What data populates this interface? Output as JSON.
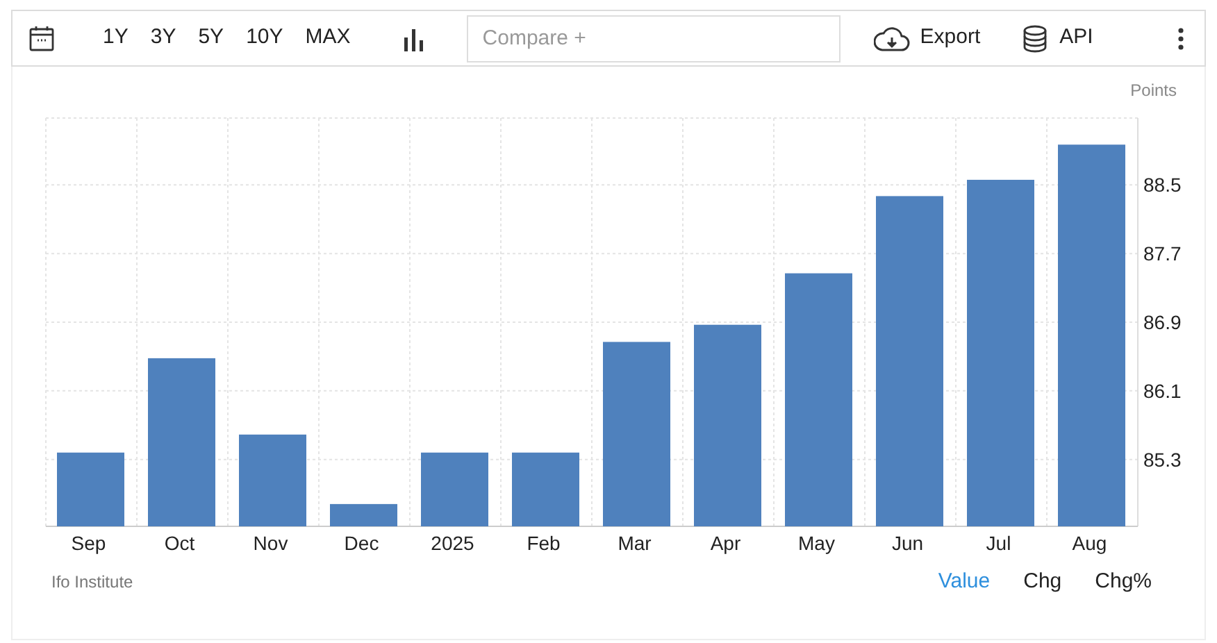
{
  "toolbar": {
    "ranges": [
      {
        "label": "1Y"
      },
      {
        "label": "3Y"
      },
      {
        "label": "5Y"
      },
      {
        "label": "10Y"
      },
      {
        "label": "MAX"
      }
    ],
    "compare": {
      "placeholder": "Compare +"
    },
    "export": "Export",
    "api": "API"
  },
  "chart": {
    "unit": "Points",
    "chart_data": {
      "type": "bar",
      "categories": [
        "Sep",
        "Oct",
        "Nov",
        "Dec",
        "2025",
        "Feb",
        "Mar",
        "Apr",
        "May",
        "Jun",
        "Jul",
        "Aug"
      ],
      "grid": true,
      "series": [
        {
          "color": "#4f81bd",
          "values": [
            85.38,
            86.48,
            85.59,
            84.78,
            85.38,
            85.38,
            86.67,
            86.87,
            87.47,
            88.37,
            88.56,
            88.97
          ]
        }
      ],
      "ylim": [
        84.52,
        89.28
      ],
      "yticks": [
        85.3,
        86.1,
        86.9,
        87.7,
        88.5
      ]
    }
  },
  "footer": {
    "source": "Ifo Institute",
    "modes": [
      {
        "label": "Value",
        "selected": true
      },
      {
        "label": "Chg",
        "selected": false
      },
      {
        "label": "Chg%",
        "selected": false
      }
    ]
  }
}
